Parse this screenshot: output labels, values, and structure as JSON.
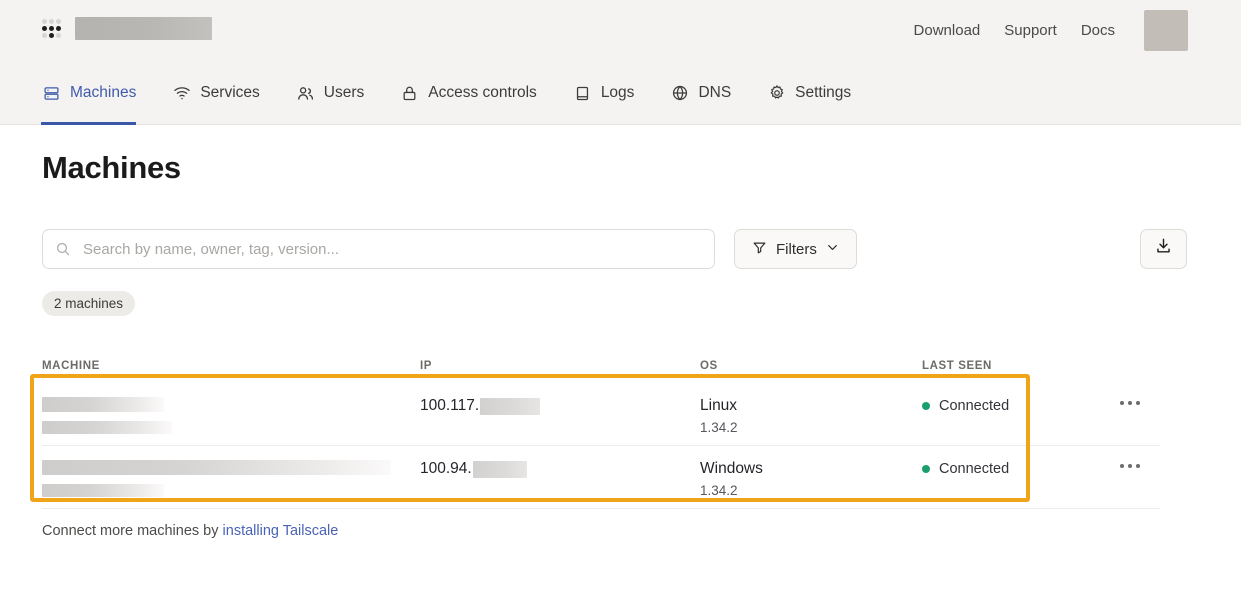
{
  "topbar": {
    "logo_icon": "app-grid-icon",
    "logo_redacted": true,
    "links": [
      {
        "label": "Download"
      },
      {
        "label": "Support"
      },
      {
        "label": "Docs"
      }
    ]
  },
  "nav": {
    "items": [
      {
        "label": "Machines",
        "icon": "server-stack-icon",
        "active": true
      },
      {
        "label": "Services",
        "icon": "wifi-icon",
        "active": false
      },
      {
        "label": "Users",
        "icon": "users-icon",
        "active": false
      },
      {
        "label": "Access controls",
        "icon": "lock-icon",
        "active": false
      },
      {
        "label": "Logs",
        "icon": "book-icon",
        "active": false
      },
      {
        "label": "DNS",
        "icon": "globe-icon",
        "active": false
      },
      {
        "label": "Settings",
        "icon": "gear-icon",
        "active": false
      }
    ],
    "active_color": "#3a57a8"
  },
  "page": {
    "title": "Machines"
  },
  "search": {
    "placeholder": "Search by name, owner, tag, version...",
    "value": "",
    "icon": "search-icon"
  },
  "filters": {
    "label": "Filters",
    "icon": "funnel-icon",
    "chevron": "chevron-down-icon"
  },
  "export": {
    "icon": "download-icon"
  },
  "count_pill": {
    "label": "2 machines"
  },
  "table": {
    "headers": {
      "machine": "MACHINE",
      "ip": "IP",
      "os": "OS",
      "last_seen": "LAST SEEN"
    },
    "rows": [
      {
        "machine_name_redacted": true,
        "machine_name_width": 122,
        "machine_sub_width": 130,
        "ip_prefix": "100.117.",
        "ip_redacted_width": 60,
        "os": "Linux",
        "version": "1.34.2",
        "status": "Connected",
        "status_color": "#1a9e6c",
        "menu_icon": "kebab-menu-icon"
      },
      {
        "machine_name_redacted": true,
        "machine_name_width": 349,
        "machine_sub_width": 122,
        "ip_prefix": "100.94.",
        "ip_redacted_width": 54,
        "os": "Windows",
        "version": "1.34.2",
        "status": "Connected",
        "status_color": "#1a9e6c",
        "menu_icon": "kebab-menu-icon"
      }
    ]
  },
  "highlight": {
    "color": "#f0a519"
  },
  "footer": {
    "text_before": "Connect more machines by ",
    "link_label": "installing Tailscale"
  }
}
